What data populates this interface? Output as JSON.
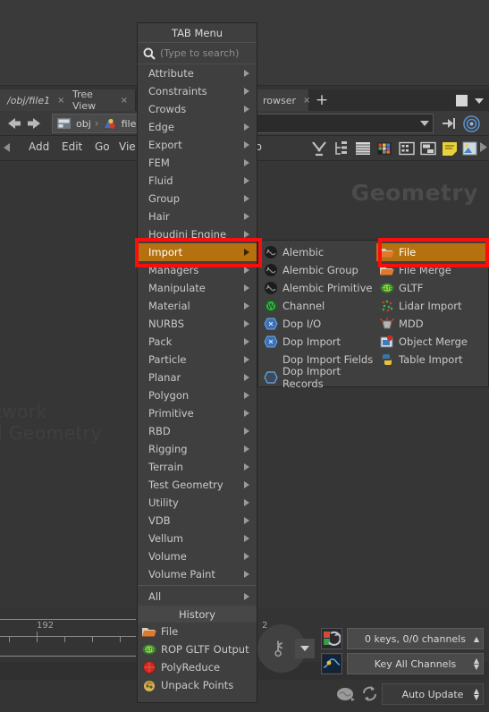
{
  "window": {
    "tabs": [
      {
        "label": "/obj/file1",
        "close": "×",
        "italic": true
      },
      {
        "label": "Tree View",
        "close": "×",
        "italic": false
      },
      {
        "label": "rowser",
        "close": "×",
        "italic": false
      }
    ],
    "add_tab_label": "+"
  },
  "pathbar": {
    "crumb_root": "obj",
    "crumb_sep": "›",
    "crumb_leaf": "file",
    "path_value": "",
    "path_placeholder": ""
  },
  "menubar": {
    "items": [
      "Add",
      "Edit",
      "Go",
      "Vie",
      "lp"
    ],
    "icons": [
      "tools-icon",
      "tree-icon",
      "list-icon",
      "color-grid-icon",
      "snapshot-icon",
      "layout-icon",
      "notes-icon",
      "image-icon",
      "play-icon"
    ]
  },
  "viewport": {
    "watermark_main": "Geometry",
    "watermark_line1": "twork",
    "watermark_line2": "d Geometry"
  },
  "timeline": {
    "frame_label": "192",
    "right_label": "2"
  },
  "playbar": {
    "keys_label": "0 keys, 0/0 channels",
    "channels_label": "Key All Channels",
    "auto_update_label": "Auto Update"
  },
  "tab_menu": {
    "title": "TAB Menu",
    "search_placeholder": "(Type to search)",
    "search_value": "",
    "search_icon": "search-icon",
    "items": [
      {
        "label": "Attribute",
        "submenu": true
      },
      {
        "label": "Constraints",
        "submenu": true
      },
      {
        "label": "Crowds",
        "submenu": true
      },
      {
        "label": "Edge",
        "submenu": true
      },
      {
        "label": "Export",
        "submenu": true
      },
      {
        "label": "FEM",
        "submenu": true
      },
      {
        "label": "Fluid",
        "submenu": true
      },
      {
        "label": "Group",
        "submenu": true
      },
      {
        "label": "Hair",
        "submenu": true
      },
      {
        "label": "Houdini Engine",
        "submenu": true
      },
      {
        "label": "Import",
        "submenu": true,
        "selected": true
      },
      {
        "label": "Managers",
        "submenu": true
      },
      {
        "label": "Manipulate",
        "submenu": true
      },
      {
        "label": "Material",
        "submenu": true
      },
      {
        "label": "NURBS",
        "submenu": true
      },
      {
        "label": "Pack",
        "submenu": true
      },
      {
        "label": "Particle",
        "submenu": true
      },
      {
        "label": "Planar",
        "submenu": true
      },
      {
        "label": "Polygon",
        "submenu": true
      },
      {
        "label": "Primitive",
        "submenu": true
      },
      {
        "label": "RBD",
        "submenu": true
      },
      {
        "label": "Rigging",
        "submenu": true
      },
      {
        "label": "Terrain",
        "submenu": true
      },
      {
        "label": "Test Geometry",
        "submenu": true
      },
      {
        "label": "Utility",
        "submenu": true
      },
      {
        "label": "VDB",
        "submenu": true
      },
      {
        "label": "Vellum",
        "submenu": true
      },
      {
        "label": "Volume",
        "submenu": true
      },
      {
        "label": "Volume Paint",
        "submenu": true
      }
    ],
    "all_item": {
      "label": "All",
      "submenu": true
    },
    "history_header": "History",
    "history_items": [
      {
        "label": "File",
        "icon": "folder-open-icon"
      },
      {
        "label": "ROP GLTF Output",
        "icon": "gltf-icon"
      },
      {
        "label": "PolyReduce",
        "icon": "red-sphere-icon"
      },
      {
        "label": "Unpack Points",
        "icon": "unpack-icon"
      }
    ]
  },
  "import_submenu": {
    "left_column": [
      {
        "label": "Alembic",
        "icon": "alembic-icon"
      },
      {
        "label": "Alembic Group",
        "icon": "alembic-icon"
      },
      {
        "label": "Alembic Primitive",
        "icon": "alembic-icon"
      },
      {
        "label": "Channel",
        "icon": "channel-icon"
      },
      {
        "label": "Dop I/O",
        "icon": "dop-icon"
      },
      {
        "label": "Dop Import",
        "icon": "dop-icon"
      },
      {
        "label": "Dop Import Fields",
        "icon": "none"
      },
      {
        "label": "Dop Import Records",
        "icon": "dop-outline-icon"
      }
    ],
    "right_column": [
      {
        "label": "File",
        "icon": "folder-open-icon",
        "selected": true
      },
      {
        "label": "File Merge",
        "icon": "folder-open-icon"
      },
      {
        "label": "GLTF",
        "icon": "gltf-icon"
      },
      {
        "label": "Lidar Import",
        "icon": "lidar-icon"
      },
      {
        "label": "MDD",
        "icon": "mdd-icon"
      },
      {
        "label": "Object Merge",
        "icon": "object-merge-icon"
      },
      {
        "label": "Table Import",
        "icon": "python-icon"
      }
    ]
  },
  "colors": {
    "highlight": "#b5700f",
    "annotation": "#fb0d0d",
    "panel": "#3f3f3f",
    "background": "#363636"
  }
}
